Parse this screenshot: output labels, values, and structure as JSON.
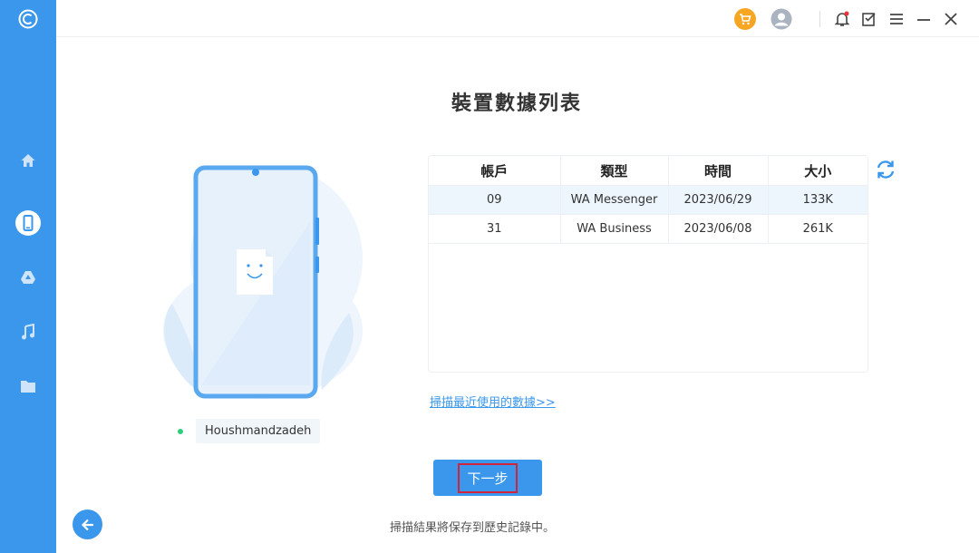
{
  "app": {
    "accent": "#3a97ec"
  },
  "sidebar": {
    "items": [
      {
        "icon": "logo-icon"
      },
      {
        "icon": "home-icon"
      },
      {
        "icon": "phone-icon",
        "active": true
      },
      {
        "icon": "google-drive-icon"
      },
      {
        "icon": "music-icon"
      },
      {
        "icon": "folder-icon"
      }
    ]
  },
  "topbar": {
    "icons": [
      "cart-icon",
      "user-icon",
      "notification-icon",
      "feedback-icon",
      "menu-icon",
      "minimize-icon",
      "close-icon"
    ]
  },
  "main": {
    "title": "裝置數據列表",
    "device_name": "Houshmandzadeh",
    "table": {
      "headers": [
        "帳戶",
        "類型",
        "時間",
        "大小"
      ],
      "rows": [
        [
          "09",
          "WA Messenger",
          "2023/06/29",
          "133K"
        ],
        [
          "31",
          "WA Business",
          "2023/06/08",
          "261K"
        ]
      ]
    },
    "recent_link": "掃描最近使用的數據>>",
    "next_button": "下一步",
    "note": "掃描結果將保存到歷史記錄中。"
  }
}
